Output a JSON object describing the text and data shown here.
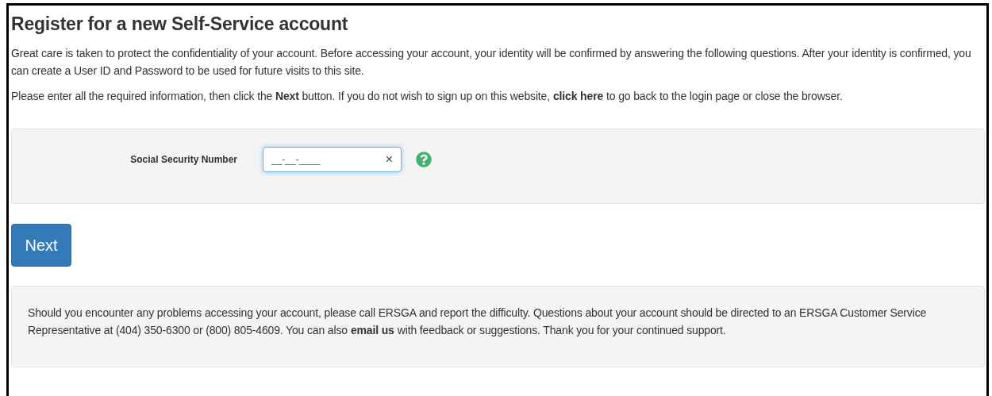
{
  "title": "Register for a new Self-Service account",
  "intro": "Great care is taken to protect the confidentiality of your account. Before accessing your account, your identity will be confirmed by answering the following questions. After your identity is confirmed, you can create a User ID and Password to be used for future visits to this site.",
  "instructions": {
    "before": "Please enter all the required information, then click the **Next** button. If you do not wish to sign up on this website,",
    "link": "click here",
    "after": "to go back to the login page or close the browser."
  },
  "form": {
    "fields": [
      {
        "label": "Social Security Number",
        "value": "__-__-____",
        "focused": true,
        "clear": "×"
      }
    ]
  },
  "next_button": "Next",
  "footer": {
    "before": "Should you encounter any problems accessing your account, please call ERSGA and report the difficulty. Questions about your account should be directed to an ERSGA Customer Service Representative at (404) 350-6300 or (800) 805-4609. You can also",
    "link": "email us",
    "after": "with feedback or suggestions. Thank you for your continued support."
  }
}
